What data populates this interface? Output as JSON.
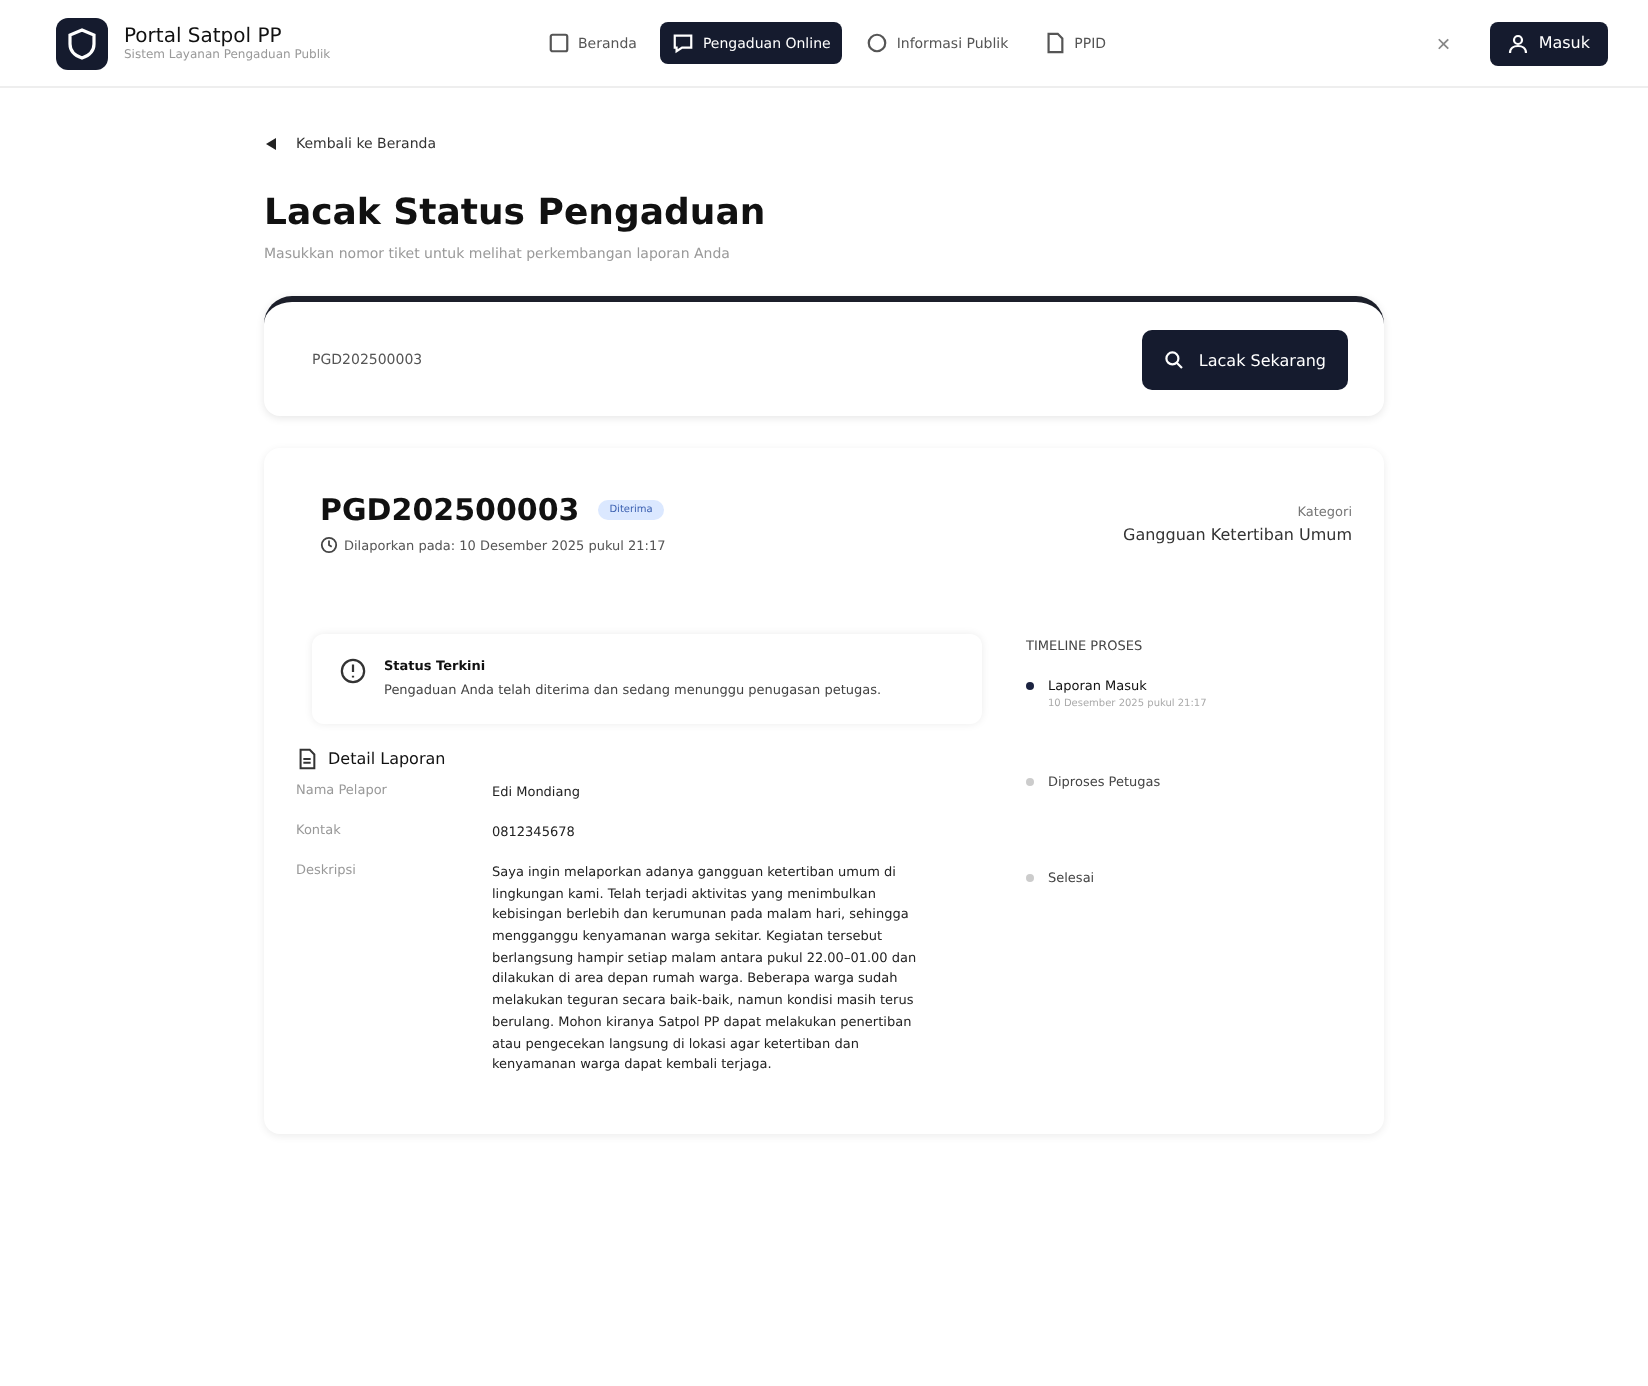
{
  "brand": {
    "title": "Portal Satpol PP",
    "subtitle": "Sistem Layanan Pengaduan Publik"
  },
  "nav": [
    {
      "label": "Beranda",
      "kind": "home",
      "selected": false
    },
    {
      "label": "Pengaduan Online",
      "kind": "chat",
      "selected": true
    },
    {
      "label": "Informasi Publik",
      "kind": "info",
      "selected": false
    },
    {
      "label": "PPID",
      "kind": "doc",
      "selected": false
    }
  ],
  "close_symbol": "×",
  "login": "Masuk",
  "back_link": "Kembali ke Beranda",
  "title": "Lacak Status Pengaduan",
  "subtitle": "Masukkan nomor tiket untuk melihat perkembangan laporan Anda",
  "search": {
    "value": "PGD202500003",
    "button": "Lacak Sekarang"
  },
  "report": {
    "ticket": "PGD202500003",
    "status": "Diterima",
    "reported": "Dilaporkan pada: 10 Desember 2025 pukul 21:17",
    "category_label": "Kategori",
    "category": "Gangguan Ketertiban Umum",
    "current_status": {
      "title": "Status Terkini",
      "text": "Pengaduan Anda telah diterima dan sedang menunggu penugasan petugas."
    },
    "detail_title": "Detail Laporan",
    "details": [
      {
        "label": "Nama Pelapor",
        "value": "Edi Mondiang"
      },
      {
        "label": "Kontak",
        "value": "0812345678"
      },
      {
        "label": "Deskripsi",
        "value": "Saya ingin melaporkan adanya gangguan ketertiban umum di lingkungan kami. Telah terjadi aktivitas yang menimbulkan kebisingan berlebih dan kerumunan pada malam hari, sehingga mengganggu kenyamanan warga sekitar. Kegiatan tersebut berlangsung hampir setiap malam antara pukul 22.00–01.00 dan dilakukan di area depan rumah warga. Beberapa warga sudah melakukan teguran secara baik-baik, namun kondisi masih terus berulang. Mohon kiranya Satpol PP dapat melakukan penertiban atau pengecekan langsung di lokasi agar ketertiban dan kenyamanan warga dapat kembali terjaga."
      }
    ],
    "timeline_title": "TIMELINE PROSES",
    "timeline": [
      {
        "label": "Laporan Masuk",
        "time": "10 Desember 2025 pukul 21:17",
        "done": true
      },
      {
        "label": "Diproses Petugas",
        "done": false
      },
      {
        "label": "Selesai",
        "done": false
      }
    ]
  }
}
